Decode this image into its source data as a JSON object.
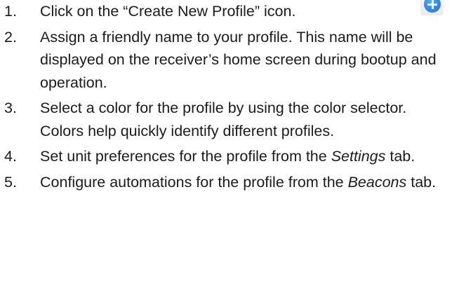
{
  "steps": [
    {
      "number": "1.",
      "parts": [
        "Click on the “Create New Profile” icon."
      ]
    },
    {
      "number": "2.",
      "parts": [
        "Assign a friendly name to your profile. This name will be displayed on the receiver’s home screen during bootup and operation."
      ]
    },
    {
      "number": "3.",
      "parts": [
        "Select a color for the profile by using the color selector. Colors help quickly identify different profiles."
      ]
    },
    {
      "number": "4.",
      "before": "Set unit preferences for the profile from the ",
      "emphasis": "Settings",
      "after": " tab."
    },
    {
      "number": "5.",
      "before": "Configure automations for the profile from the ",
      "emphasis": "Beacons",
      "after": " tab."
    }
  ],
  "icon": {
    "name": "create-new-profile-icon",
    "color": "#2f86de"
  }
}
